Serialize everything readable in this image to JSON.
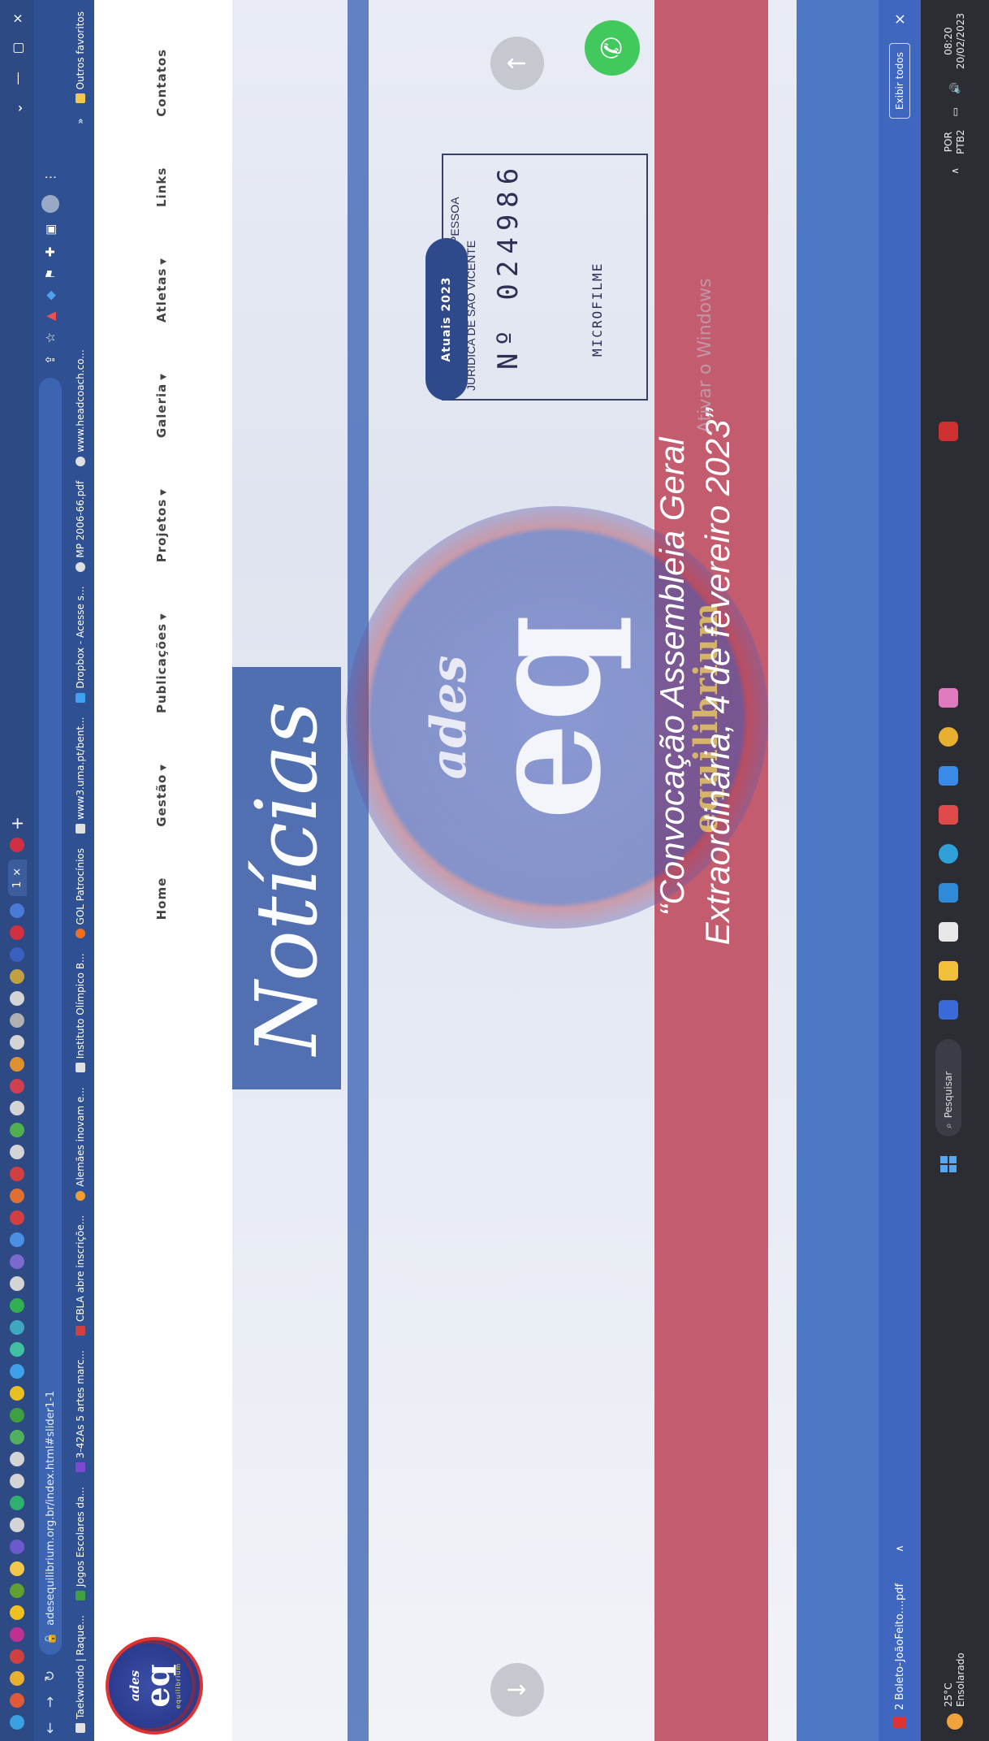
{
  "browser": {
    "active_tab_label": "1",
    "tab_close": "×",
    "new_tab": "+",
    "window_controls": {
      "minimize": "—",
      "maximize": "▢",
      "close": "×"
    },
    "address": "adesequilibrium.org.br/index.html#slider1-1",
    "bookmarks": [
      "Taekwondo | Raque...",
      "Jogos Escolares da...",
      "3-42As 5 artes marc...",
      "CBLA abre inscriçõe...",
      "Alemães inovam e...",
      "Instituto Olímpico B...",
      "GOL Patrocínios",
      "www3.uma.pt/bent...",
      "Dropbox - Acesse s...",
      "MP 2006-66.pdf",
      "www.headcoach.co..."
    ],
    "bookmarks_more": "»",
    "other_bookmarks": "Outros favoritos"
  },
  "site": {
    "logo": {
      "top": "ades",
      "main": "eq",
      "bottom": "equilibrium"
    },
    "nav": [
      {
        "label": "Home",
        "dropdown": false
      },
      {
        "label": "Gestão",
        "dropdown": true
      },
      {
        "label": "Publicações",
        "dropdown": true
      },
      {
        "label": "Projetos",
        "dropdown": true
      },
      {
        "label": "Galeria",
        "dropdown": true
      },
      {
        "label": "Atletas",
        "dropdown": true
      },
      {
        "label": "Links",
        "dropdown": false
      },
      {
        "label": "Contatos",
        "dropdown": false
      }
    ],
    "hero": {
      "heading": "Notícias",
      "emblem": {
        "top": "ades",
        "main": "eq",
        "bottom": "equilibrium"
      },
      "announcement_line1": "“Convocação Assembleia Geral",
      "announcement_line2": "Extraordinária, 4 de fevereiro 2023”",
      "badge": "Atuais 2023",
      "prev_arrow": "↓",
      "next_arrow": "↑",
      "watermark": "Ativar o Windows"
    },
    "whatsapp_icon": "whatsapp-icon"
  },
  "stamp": {
    "line1": "OFICIAL DE REG. CIVIL DE PESSOA",
    "line2": "JURÍDICA DE SÃO VICENTE",
    "number": "Nº 024986",
    "footer": "MICROFILME"
  },
  "downloads": {
    "file": "2 Boleto-JoãoFeito....pdf",
    "show_all": "Exibir todos",
    "close": "×"
  },
  "taskbar": {
    "temperature": "25°C",
    "weather": "Ensolarado",
    "search": "Pesquisar",
    "lang": "POR",
    "layout": "PTB2",
    "time": "08:20",
    "date": "20/02/2023"
  },
  "colors": {
    "tabbar": "#2d4a85",
    "hero_red_band": "#c45c70",
    "hero_blue_band": "#4d78c6",
    "whatsapp": "#41c95e"
  }
}
